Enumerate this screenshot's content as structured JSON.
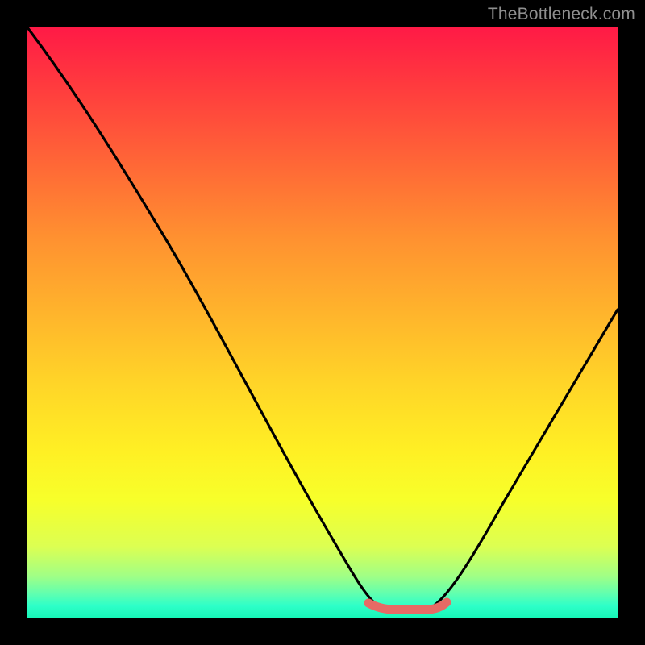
{
  "watermark": "TheBottleneck.com",
  "colors": {
    "frame": "#000000",
    "curve": "#000000",
    "highlight": "#e66a65",
    "gradient_top": "#ff1a46",
    "gradient_bottom": "#17f7b8"
  },
  "chart_data": {
    "type": "line",
    "title": "",
    "xlabel": "",
    "ylabel": "",
    "xlim": [
      0,
      100
    ],
    "ylim": [
      0,
      100
    ],
    "x": [
      0,
      5,
      10,
      15,
      20,
      25,
      30,
      35,
      40,
      45,
      50,
      55,
      58,
      60,
      62,
      65,
      68,
      70,
      75,
      80,
      85,
      90,
      95,
      100
    ],
    "values": [
      100,
      94,
      86,
      78,
      70,
      62,
      53,
      45,
      36,
      27,
      18,
      9,
      3,
      1,
      0,
      0,
      0,
      1,
      5,
      12,
      20,
      28,
      36,
      44
    ],
    "highlight_x_range": [
      58,
      70
    ],
    "annotations": []
  }
}
